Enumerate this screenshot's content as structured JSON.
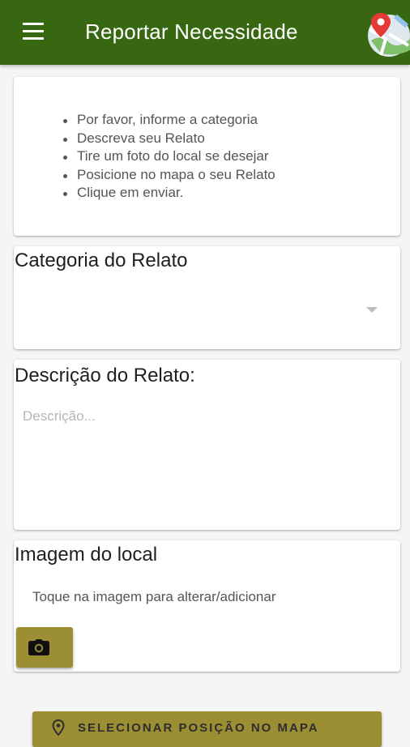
{
  "header": {
    "title": "Reportar Necessidade",
    "menu_icon": "hamburger-menu-icon",
    "map_icon": "map-pin-icon",
    "color": "#376811"
  },
  "instructions": {
    "items": [
      "Por favor, informe a categoria",
      "Descreva seu Relato",
      "Tire um foto do local se desejar",
      "Posicione no mapa o seu Relato",
      "Clique em enviar."
    ]
  },
  "category": {
    "title": "Categoria do Relato",
    "selected_value": ""
  },
  "description": {
    "title": "Descrição do Relato:",
    "placeholder": "Descrição...",
    "value": ""
  },
  "image": {
    "title": "Imagem do local",
    "hint": "Toque na imagem para alterar/adicionar",
    "camera_icon": "camera-icon"
  },
  "map_button": {
    "label": "SELECIONAR POSIÇÃO NO MAPA",
    "icon": "location-pin-icon"
  },
  "colors": {
    "accent": "#9c8e32",
    "header": "#376811"
  }
}
